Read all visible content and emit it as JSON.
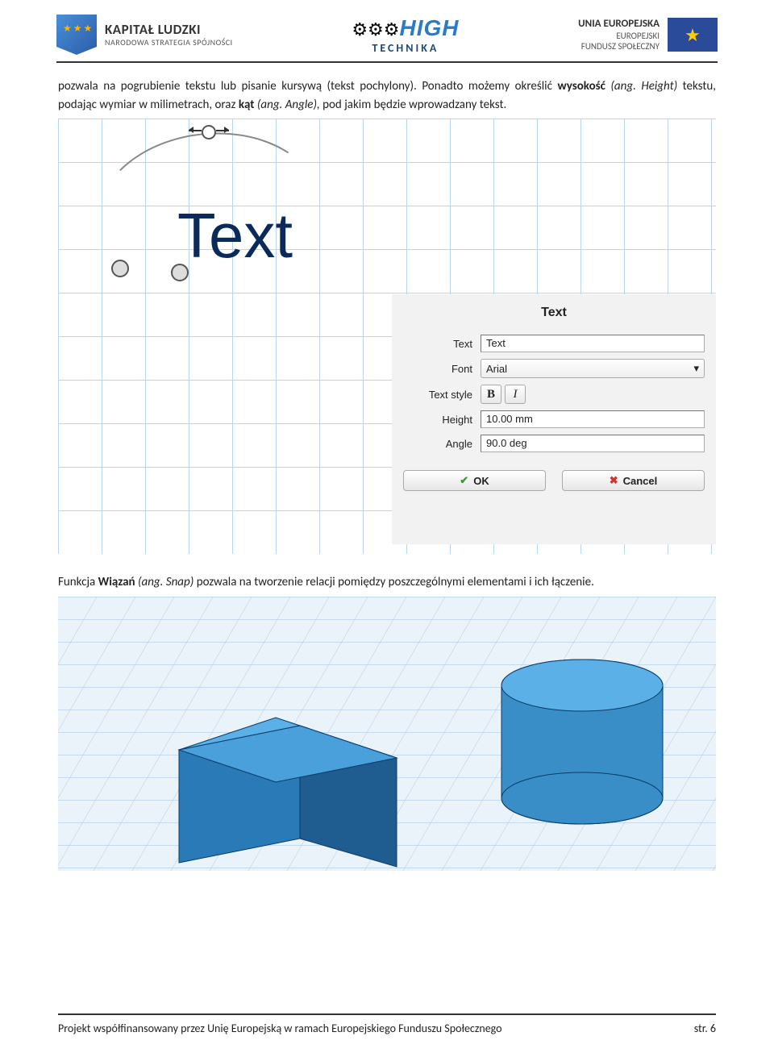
{
  "header": {
    "kl_title": "KAPITAŁ LUDZKI",
    "kl_sub": "NARODOWA STRATEGIA SPÓJNOŚCI",
    "ht_top": "HIGH",
    "ht_bot": "TECHNIKA",
    "eu_l1": "UNIA EUROPEJSKA",
    "eu_l2": "EUROPEJSKI",
    "eu_l3": "FUNDUSZ SPOŁECZNY"
  },
  "para1_parts": {
    "a": "pozwala na pogrubienie tekstu lub pisanie kursywą (tekst pochylony). Ponadto możemy określić ",
    "b": "wysokość",
    "c": " (ang. Height)",
    "d": " tekstu, podając wymiar w milimetrach, oraz ",
    "e": "kąt",
    "f": " (ang. Angle),",
    "g": " pod jakim będzie wprowadzany tekst."
  },
  "figure1": {
    "text_sample": "Text",
    "panel": {
      "title": "Text",
      "labels": {
        "text": "Text",
        "font": "Font",
        "style": "Text style",
        "height": "Height",
        "angle": "Angle"
      },
      "values": {
        "text": "Text",
        "font": "Arial",
        "height": "10.00 mm",
        "angle": "90.0 deg"
      },
      "style_btns": {
        "bold": "B",
        "italic": "I"
      },
      "ok": "OK",
      "cancel": "Cancel"
    }
  },
  "para2_parts": {
    "a": "Funkcja ",
    "b": "Wiązań",
    "c": " (ang. Snap)",
    "d": " pozwala na tworzenie relacji pomiędzy poszczególnymi elementami i ich łączenie."
  },
  "footer": {
    "text": "Projekt współfinansowany przez Unię Europejską w ramach Europejskiego Funduszu Społecznego",
    "page": "str. 6"
  }
}
